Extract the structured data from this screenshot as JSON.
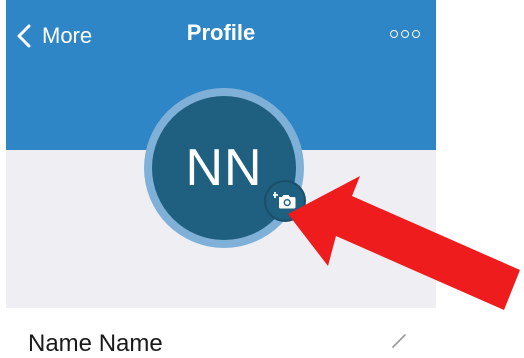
{
  "header": {
    "back_label": "More",
    "title": "Profile"
  },
  "avatar": {
    "initials": "NN"
  },
  "profile": {
    "name": "Name Name"
  },
  "colors": {
    "header_blue": "#2f86c6",
    "avatar_navy": "#1f5f7f",
    "gray_band": "#efeff3",
    "arrow_red": "#ee1c1c"
  },
  "icons": {
    "back": "chevron-left-icon",
    "more": "more-horizontal-icon",
    "camera": "camera-add-icon",
    "edit": "pencil-icon",
    "annotation": "red-arrow-annotation"
  }
}
